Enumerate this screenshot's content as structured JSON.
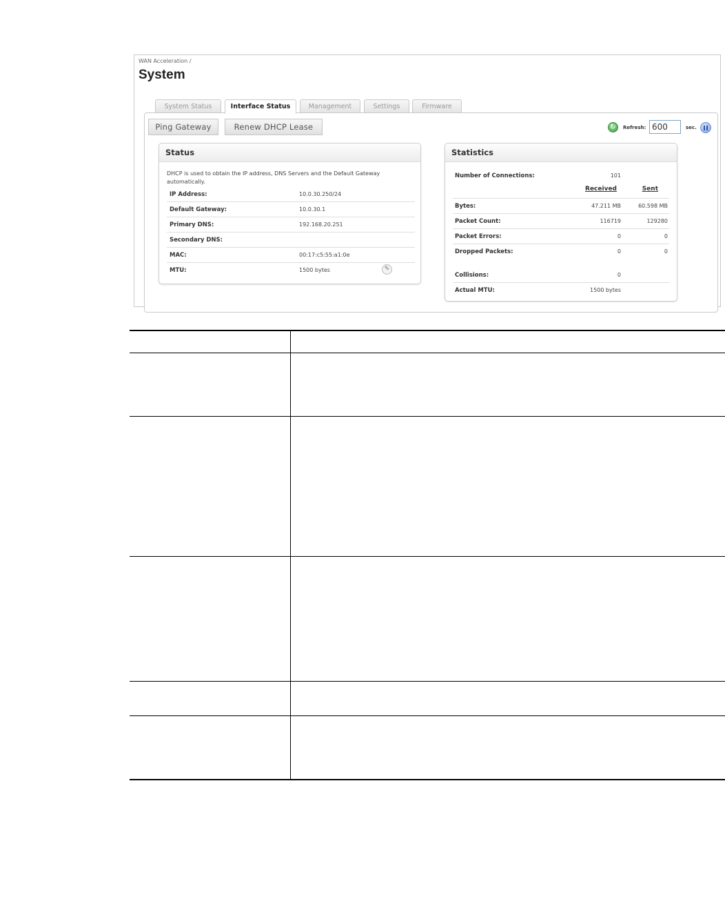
{
  "breadcrumb": "WAN Acceleration /",
  "page_title": "System",
  "tabs": [
    {
      "label": "System Status",
      "active": false
    },
    {
      "label": "Interface Status",
      "active": true
    },
    {
      "label": "Management",
      "active": false
    },
    {
      "label": "Settings",
      "active": false
    },
    {
      "label": "Firmware",
      "active": false
    }
  ],
  "toolbar": {
    "ping_label": "Ping Gateway",
    "renew_label": "Renew DHCP Lease",
    "refresh_label": "Refresh:",
    "refresh_value": "600",
    "sec_label": "sec.",
    "refresh_icon": "refresh-icon",
    "pause_icon": "pause-icon"
  },
  "status": {
    "heading": "Status",
    "description": "DHCP is used to obtain the IP address, DNS Servers and the Default Gateway automatically.",
    "rows": [
      {
        "label": "IP Address:",
        "value": "10.0.30.250/24"
      },
      {
        "label": "Default Gateway:",
        "value": "10.0.30.1"
      },
      {
        "label": "Primary DNS:",
        "value": "192.168.20.251"
      },
      {
        "label": "Secondary DNS:",
        "value": ""
      },
      {
        "label": "MAC:",
        "value": "00:17:c5:55:a1:0e"
      },
      {
        "label": "MTU:",
        "value": "1500 bytes"
      }
    ],
    "edit_icon": "pencil-icon"
  },
  "statistics": {
    "heading": "Statistics",
    "connections_label": "Number of Connections:",
    "connections_value": "101",
    "received_header": "Received",
    "sent_header": "Sent",
    "rows": [
      {
        "label": "Bytes:",
        "received": "47.211 MB",
        "sent": "60.598 MB"
      },
      {
        "label": "Packet Count:",
        "received": "116719",
        "sent": "129280"
      },
      {
        "label": "Packet Errors:",
        "received": "0",
        "sent": "0"
      },
      {
        "label": "Dropped Packets:",
        "received": "0",
        "sent": "0"
      }
    ],
    "collisions_label": "Collisions:",
    "collisions_value": "0",
    "actual_mtu_label": "Actual MTU:",
    "actual_mtu_value": "1500 bytes"
  },
  "colors": {
    "border": "#c9c9c9",
    "accent_blue": "#7fa3c4",
    "refresh_green": "#3d9a3d"
  }
}
